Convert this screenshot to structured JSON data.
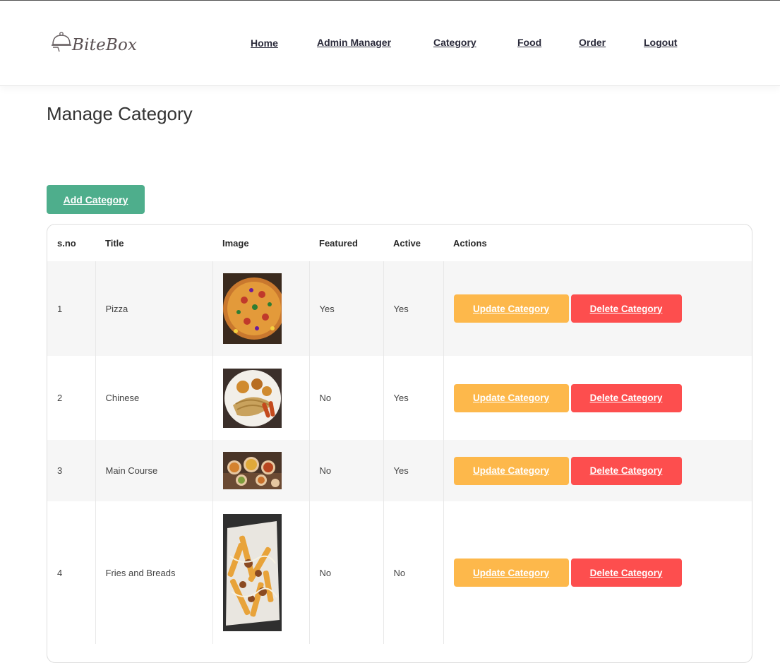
{
  "brand": {
    "name": "BiteBox"
  },
  "nav": {
    "items": [
      {
        "label": "Home"
      },
      {
        "label": "Admin Manager"
      },
      {
        "label": "Category"
      },
      {
        "label": "Food"
      },
      {
        "label": "Order"
      },
      {
        "label": "Logout"
      }
    ]
  },
  "page": {
    "title": "Manage Category"
  },
  "actions": {
    "add_label": "Add Category"
  },
  "table": {
    "headers": [
      "s.no",
      "Title",
      "Image",
      "Featured",
      "Active",
      "Actions"
    ],
    "rows": [
      {
        "sno": "1",
        "title": "Pizza",
        "featured": "Yes",
        "active": "Yes",
        "image": "pizza"
      },
      {
        "sno": "2",
        "title": "Chinese",
        "featured": "No",
        "active": "Yes",
        "image": "chinese"
      },
      {
        "sno": "3",
        "title": "Main Course",
        "featured": "No",
        "active": "Yes",
        "image": "main-course"
      },
      {
        "sno": "4",
        "title": "Fries and Breads",
        "featured": "No",
        "active": "No",
        "image": "fries"
      }
    ],
    "update_label": "Update Category",
    "delete_label": "Delete Category"
  },
  "colors": {
    "add_button": "#4eae8c",
    "update_button": "#fdb84b",
    "delete_button": "#fd4e4e"
  }
}
